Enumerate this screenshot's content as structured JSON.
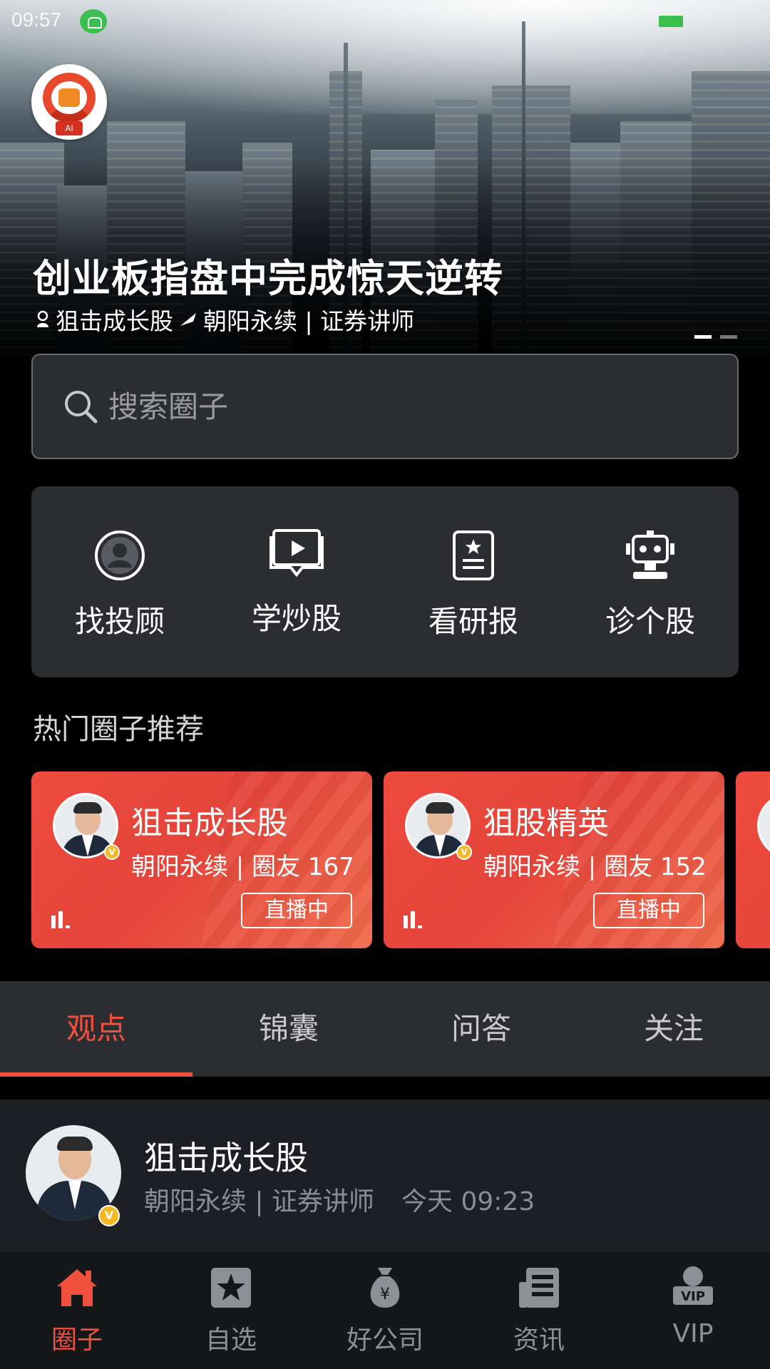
{
  "status_bar": {
    "time": "09:57"
  },
  "banner": {
    "logo_badge": "AI",
    "title": "创业板指盘中完成惊天逆转",
    "circle_name": "狙击成长股",
    "author_line": "朝阳永续 | 证券讲师"
  },
  "search": {
    "placeholder": "搜索圈子"
  },
  "quick_actions": [
    {
      "label": "找投顾",
      "icon": "advisor-icon"
    },
    {
      "label": "学炒股",
      "icon": "video-lesson-icon"
    },
    {
      "label": "看研报",
      "icon": "report-icon"
    },
    {
      "label": "诊个股",
      "icon": "robot-icon"
    }
  ],
  "hot_section": {
    "title": "热门圈子推荐"
  },
  "hot_circles": [
    {
      "name": "狙击成长股",
      "subtitle": "朝阳永续 | 圈友 167",
      "live_label": "直播中"
    },
    {
      "name": "狙股精英",
      "subtitle": "朝阳永续 | 圈友 152",
      "live_label": "直播中"
    }
  ],
  "tabs": [
    {
      "label": "观点",
      "active": true
    },
    {
      "label": "锦囊",
      "active": false
    },
    {
      "label": "问答",
      "active": false
    },
    {
      "label": "关注",
      "active": false
    }
  ],
  "post": {
    "author": "狙击成长股",
    "role": "朝阳永续 | 证券讲师",
    "time": "今天 09:23"
  },
  "bottom_nav": [
    {
      "label": "圈子",
      "icon": "home-icon",
      "active": true
    },
    {
      "label": "自选",
      "icon": "star-icon",
      "active": false
    },
    {
      "label": "好公司",
      "icon": "money-bag-icon",
      "active": false
    },
    {
      "label": "资讯",
      "icon": "news-icon",
      "active": false
    },
    {
      "label": "VIP",
      "icon": "vip-icon",
      "active": false
    }
  ],
  "colors": {
    "accent": "#f1503f",
    "card_red": "#e4443a",
    "panel": "#2c2d31",
    "badge_gold": "#f5b821"
  }
}
